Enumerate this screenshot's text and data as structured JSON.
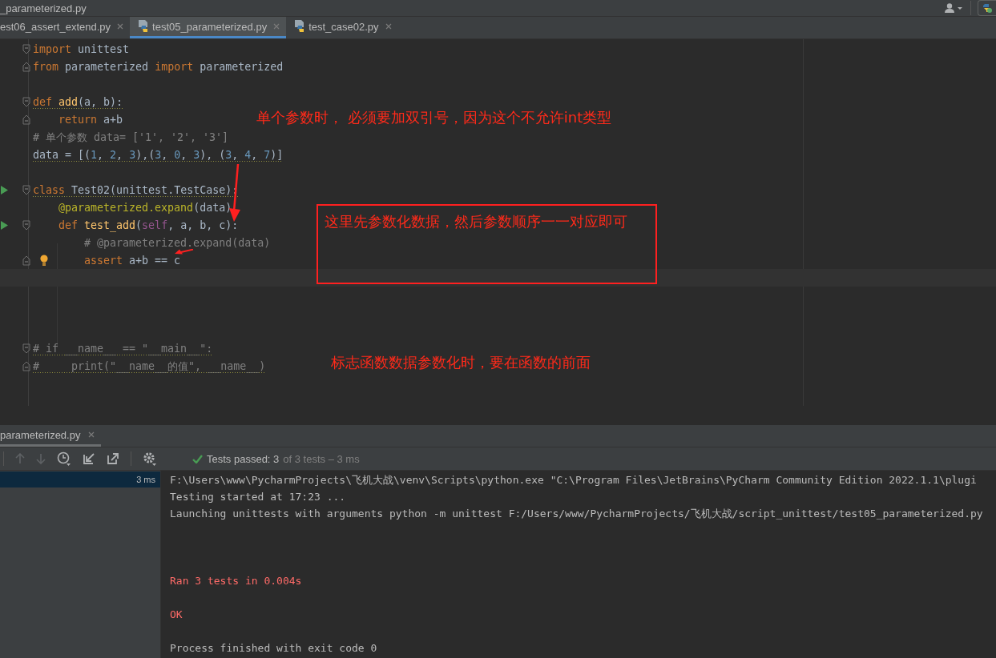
{
  "window": {
    "title": "_parameterized.py"
  },
  "tabs": [
    {
      "label": "est06_assert_extend.py",
      "selected": false,
      "icon": false
    },
    {
      "label": "test05_parameterized.py",
      "selected": true,
      "icon": true
    },
    {
      "label": "test_case02.py",
      "selected": false,
      "icon": true
    }
  ],
  "code": {
    "lines": [
      {
        "kind": "code",
        "fold_start": true,
        "tokens": [
          {
            "kind": "keyword",
            "text": "import"
          },
          {
            "kind": "name",
            "text": " unittest"
          }
        ]
      },
      {
        "kind": "code",
        "fold_end": true,
        "tokens": [
          {
            "kind": "keyword",
            "text": "from"
          },
          {
            "kind": "name",
            "text": " parameterized "
          },
          {
            "kind": "keyword",
            "text": "import"
          },
          {
            "kind": "name",
            "text": " parameterized"
          }
        ]
      },
      {
        "kind": "blank"
      },
      {
        "kind": "code",
        "fold_start": true,
        "warning": true,
        "tokens": [
          {
            "kind": "keyword",
            "text": "def "
          },
          {
            "kind": "function",
            "text": "add"
          },
          {
            "kind": "name",
            "text": "(a, b):"
          }
        ]
      },
      {
        "kind": "code",
        "fold_end": true,
        "tokens": [
          {
            "kind": "keyword",
            "text": "    return"
          },
          {
            "kind": "name",
            "text": " a+b"
          }
        ]
      },
      {
        "kind": "code",
        "tokens": [
          {
            "kind": "comment",
            "text": "# 单个参数 data= ['1', '2', '3']"
          }
        ]
      },
      {
        "kind": "code",
        "warning": true,
        "tokens": [
          {
            "kind": "name",
            "text": "data = [("
          },
          {
            "kind": "number",
            "text": "1"
          },
          {
            "kind": "name",
            "text": ", "
          },
          {
            "kind": "number",
            "text": "2"
          },
          {
            "kind": "name",
            "text": ", "
          },
          {
            "kind": "number",
            "text": "3"
          },
          {
            "kind": "name",
            "text": "),("
          },
          {
            "kind": "number",
            "text": "3"
          },
          {
            "kind": "name",
            "text": ", "
          },
          {
            "kind": "number",
            "text": "0"
          },
          {
            "kind": "name",
            "text": ", "
          },
          {
            "kind": "number",
            "text": "3"
          },
          {
            "kind": "name",
            "text": "), ("
          },
          {
            "kind": "number",
            "text": "3"
          },
          {
            "kind": "name",
            "text": ", "
          },
          {
            "kind": "number",
            "text": "4"
          },
          {
            "kind": "name",
            "text": ", "
          },
          {
            "kind": "number",
            "text": "7"
          },
          {
            "kind": "name",
            "text": ")]"
          }
        ]
      },
      {
        "kind": "blank"
      },
      {
        "kind": "code",
        "fold_start": true,
        "run": true,
        "warning": true,
        "tokens": [
          {
            "kind": "keyword",
            "text": "class "
          },
          {
            "kind": "name",
            "text": "Test02(unittest.TestCase):"
          }
        ]
      },
      {
        "kind": "code",
        "tokens": [
          {
            "kind": "decorator",
            "text": "    @parameterized.expand"
          },
          {
            "kind": "name",
            "text": "(data)"
          }
        ]
      },
      {
        "kind": "code",
        "fold_start": true,
        "run": true,
        "tokens": [
          {
            "kind": "keyword",
            "text": "    def "
          },
          {
            "kind": "function",
            "text": "test_add"
          },
          {
            "kind": "name",
            "text": "("
          },
          {
            "kind": "self",
            "text": "self"
          },
          {
            "kind": "name",
            "text": ", a, b, c):"
          }
        ]
      },
      {
        "kind": "code",
        "tokens": [
          {
            "kind": "comment",
            "text": "        # @parameterized.expand(data)"
          }
        ]
      },
      {
        "kind": "code",
        "fold_end": true,
        "hint": true,
        "tokens": [
          {
            "kind": "keyword",
            "text": "        assert"
          },
          {
            "kind": "name",
            "text": " a+b == c"
          }
        ]
      },
      {
        "kind": "blank",
        "current": true
      },
      {
        "kind": "blank"
      },
      {
        "kind": "blank"
      },
      {
        "kind": "blank"
      },
      {
        "kind": "code",
        "fold_start": true,
        "warning": true,
        "tokens": [
          {
            "kind": "comment",
            "text": "# if __name__ == \"__main__\":"
          }
        ]
      },
      {
        "kind": "code",
        "fold_end": true,
        "warning": true,
        "tokens": [
          {
            "kind": "comment",
            "text": "#     print(\"__name__的值\", __name__)"
          }
        ]
      }
    ]
  },
  "annotations": [
    {
      "kind": "note",
      "text": "单个参数时， 必须要加双引号，因为这个不允许int类型"
    },
    {
      "kind": "boxed",
      "text": "这里先参数化数据，然后参数顺序一一对应即可"
    },
    {
      "kind": "note",
      "text": "标志函数数据参数化时，要在函数的前面"
    }
  ],
  "run_panel": {
    "tab": {
      "label": "parameterized.py"
    },
    "status": {
      "passed": "Tests passed: 3",
      "total": "of 3 tests – 3 ms"
    },
    "tree": [
      {
        "time": "3 ms",
        "selected": true
      }
    ],
    "console": [
      {
        "kind": "normal",
        "text": "F:\\Users\\www\\PycharmProjects\\飞机大战\\venv\\Scripts\\python.exe \"C:\\Program Files\\JetBrains\\PyCharm Community Edition 2022.1.1\\plugi"
      },
      {
        "kind": "normal",
        "text": "Testing started at 17:23 ..."
      },
      {
        "kind": "normal",
        "text": "Launching unittests with arguments python -m unittest F:/Users/www/PycharmProjects/飞机大战/script_unittest/test05_parameterized.py"
      },
      {
        "kind": "blank"
      },
      {
        "kind": "blank"
      },
      {
        "kind": "blank"
      },
      {
        "kind": "error",
        "text": "Ran 3 tests in 0.004s"
      },
      {
        "kind": "blank"
      },
      {
        "kind": "error",
        "text": "OK"
      },
      {
        "kind": "blank"
      },
      {
        "kind": "normal",
        "text": "Process finished with exit code 0"
      }
    ]
  }
}
